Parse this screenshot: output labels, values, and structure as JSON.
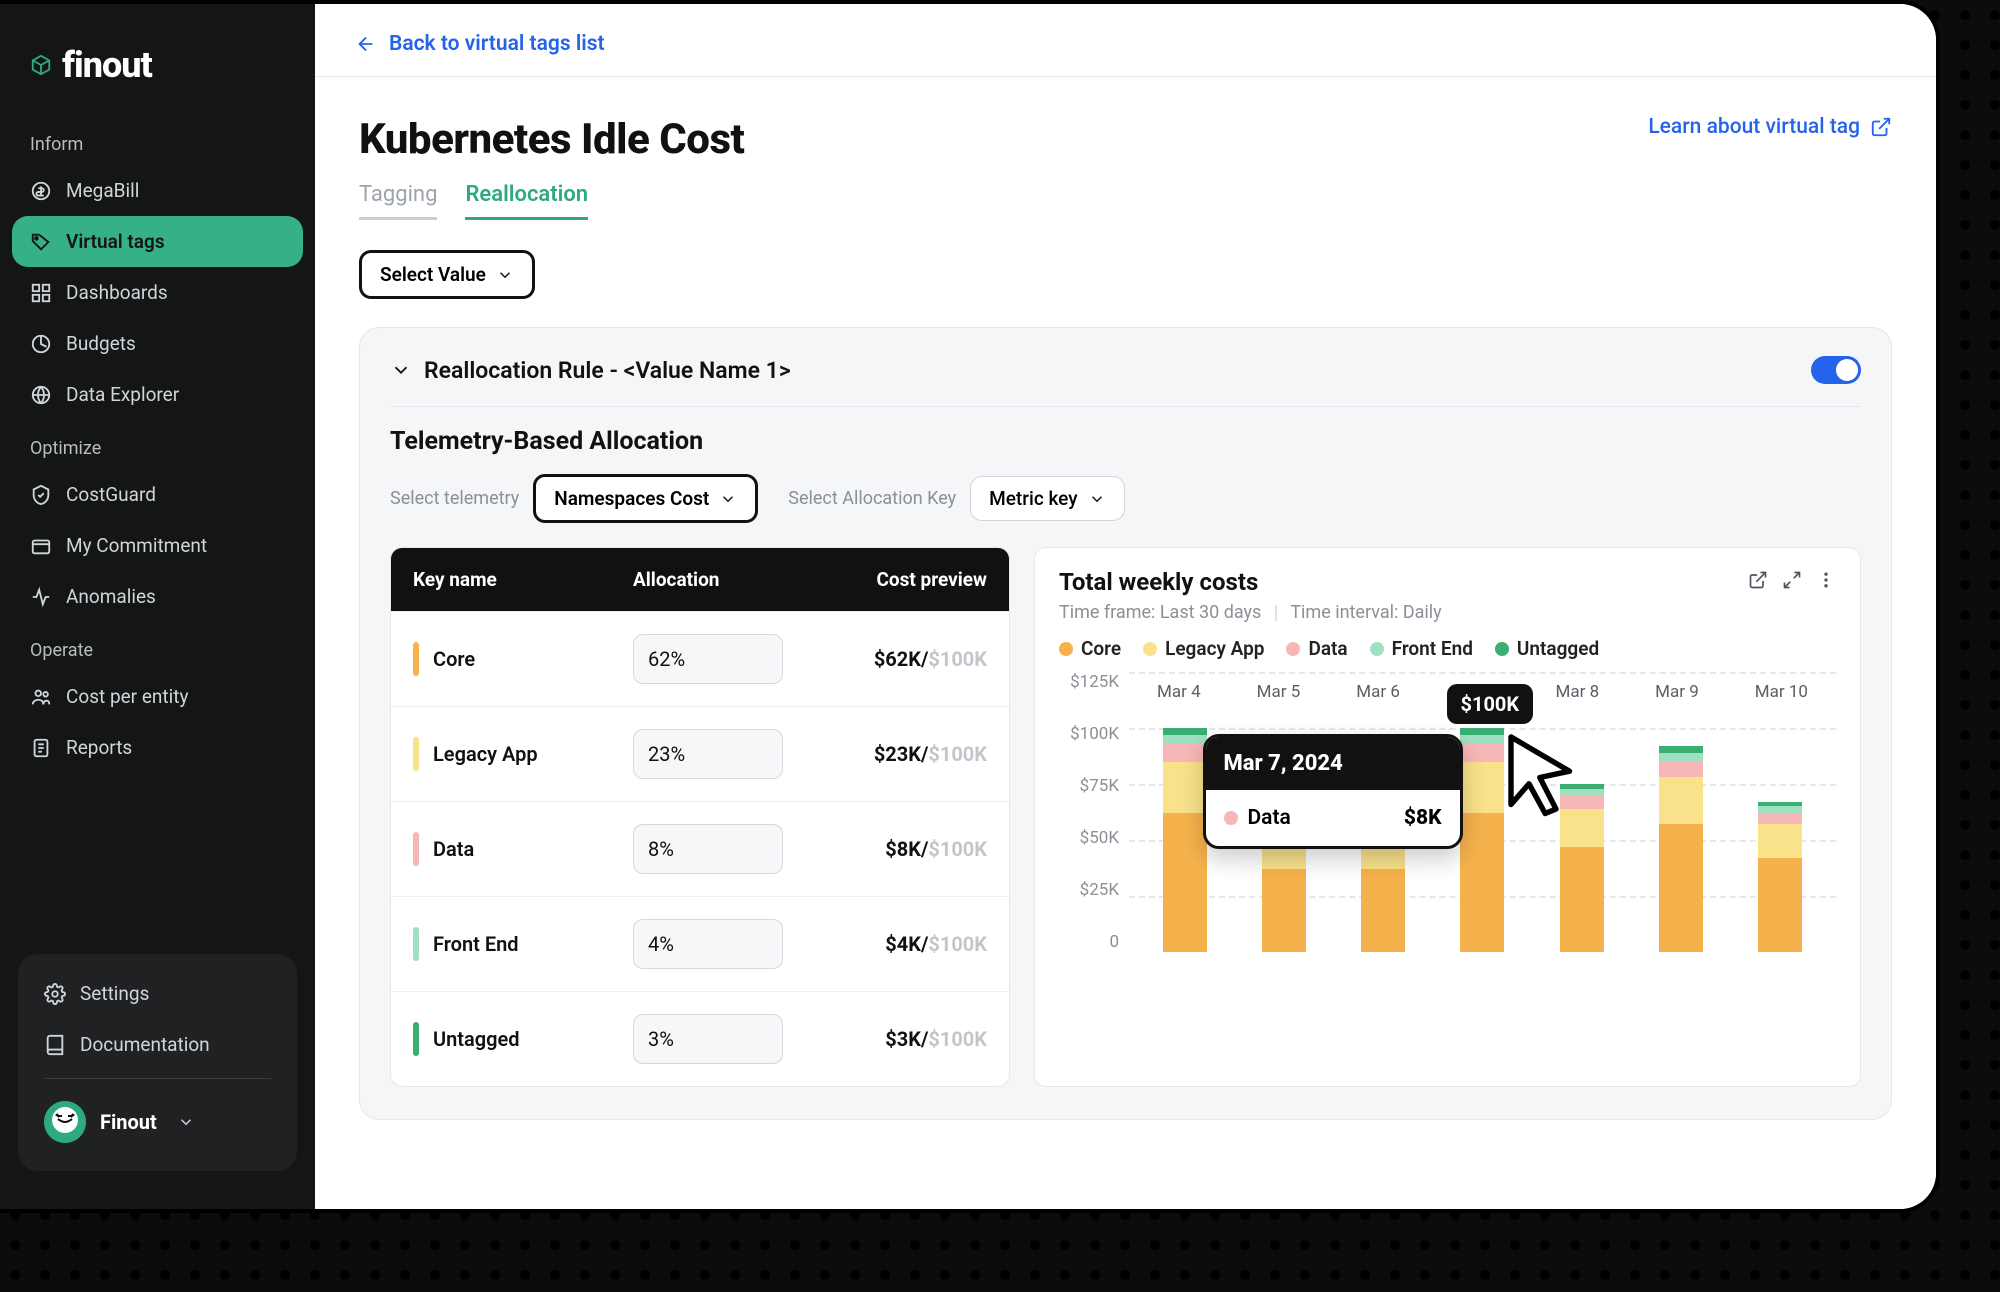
{
  "brand": {
    "name": "finout"
  },
  "sidebar": {
    "sections": [
      {
        "label": "Inform",
        "items": [
          {
            "id": "megabill",
            "label": "MegaBill",
            "active": false
          },
          {
            "id": "virtual-tags",
            "label": "Virtual tags",
            "active": true
          },
          {
            "id": "dashboards",
            "label": "Dashboards",
            "active": false
          },
          {
            "id": "budgets",
            "label": "Budgets",
            "active": false
          },
          {
            "id": "data-explorer",
            "label": "Data Explorer",
            "active": false
          }
        ]
      },
      {
        "label": "Optimize",
        "items": [
          {
            "id": "costguard",
            "label": "CostGuard",
            "active": false
          },
          {
            "id": "my-commitment",
            "label": "My Commitment",
            "active": false
          },
          {
            "id": "anomalies",
            "label": "Anomalies",
            "active": false
          }
        ]
      },
      {
        "label": "Operate",
        "items": [
          {
            "id": "cost-per-entity",
            "label": "Cost per entity",
            "active": false
          },
          {
            "id": "reports",
            "label": "Reports",
            "active": false
          }
        ]
      }
    ],
    "footer": {
      "settings": "Settings",
      "documentation": "Documentation",
      "account_name": "Finout"
    }
  },
  "main": {
    "back_label": "Back to virtual tags list",
    "title": "Kubernetes Idle Cost",
    "learn_link": "Learn about virtual tag",
    "tabs": {
      "tagging": "Tagging",
      "reallocation": "Reallocation"
    },
    "select_value_label": "Select Value",
    "rule": {
      "title": "Reallocation Rule - <Value Name 1>",
      "enabled": true,
      "section_title": "Telemetry-Based Allocation",
      "telemetry_label": "Select telemetry",
      "telemetry_value": "Namespaces Cost",
      "alloc_key_label": "Select Allocation Key",
      "alloc_key_value": "Metric key"
    },
    "table": {
      "headers": {
        "key": "Key name",
        "alloc": "Allocation",
        "preview": "Cost preview"
      },
      "cap": "$100K",
      "rows": [
        {
          "name": "Core",
          "color": "#f5b24c",
          "alloc": "62%",
          "cost": "$62K/"
        },
        {
          "name": "Legacy App",
          "color": "#f9e28a",
          "alloc": "23%",
          "cost": "$23K/"
        },
        {
          "name": "Data",
          "color": "#f7b7b7",
          "alloc": "8%",
          "cost": "$8K/"
        },
        {
          "name": "Front End",
          "color": "#9fe0c2",
          "alloc": "4%",
          "cost": "$4K/"
        },
        {
          "name": "Untagged",
          "color": "#3aae73",
          "alloc": "3%",
          "cost": "$3K/"
        }
      ]
    },
    "chart": {
      "title": "Total weekly costs",
      "timeframe_label": "Time frame: Last 30 days",
      "interval_label": "Time interval: Daily",
      "legend": [
        "Core",
        "Legacy App",
        "Data",
        "Front End",
        "Untagged"
      ],
      "y_ticks": [
        "$125K",
        "$100K",
        "$75K",
        "$50K",
        "$25K",
        "0"
      ],
      "x_labels": [
        "Mar 4",
        "Mar 5",
        "Mar 6",
        "Mar 7",
        "Mar 8",
        "Mar 9",
        "Mar 10"
      ],
      "value_bubble": "$100K",
      "tooltip": {
        "date": "Mar 7, 2024",
        "key": "Data",
        "value": "$8K",
        "swatch": "#f7b7b7"
      }
    }
  },
  "colors": {
    "core": "#f5b24c",
    "legacy": "#f9e28a",
    "data": "#f7b7b7",
    "front": "#9fe0c2",
    "untagged": "#3aae73"
  },
  "chart_data": {
    "type": "bar",
    "stacked": true,
    "title": "Total weekly costs",
    "xlabel": "",
    "ylabel": "",
    "ylim": [
      0,
      125
    ],
    "y_unit": "$K",
    "categories": [
      "Mar 4",
      "Mar 5",
      "Mar 6",
      "Mar 7",
      "Mar 8",
      "Mar 9",
      "Mar 10"
    ],
    "series": [
      {
        "name": "Core",
        "color": "#f5b24c",
        "values": [
          62,
          37,
          37,
          62,
          47,
          57,
          42
        ]
      },
      {
        "name": "Legacy App",
        "color": "#f9e28a",
        "values": [
          23,
          14,
          14,
          23,
          17,
          21,
          15
        ]
      },
      {
        "name": "Data",
        "color": "#f7b7b7",
        "values": [
          8,
          5,
          5,
          8,
          6,
          7,
          5
        ]
      },
      {
        "name": "Front End",
        "color": "#9fe0c2",
        "values": [
          4,
          2,
          2,
          4,
          3,
          4,
          3
        ]
      },
      {
        "name": "Untagged",
        "color": "#3aae73",
        "values": [
          3,
          2,
          2,
          3,
          2,
          3,
          2
        ]
      }
    ],
    "totals": [
      100,
      60,
      60,
      100,
      75,
      92,
      67
    ],
    "tooltip_point": {
      "category": "Mar 7",
      "total": 100,
      "highlight_series": "Data",
      "highlight_value": 8
    }
  }
}
